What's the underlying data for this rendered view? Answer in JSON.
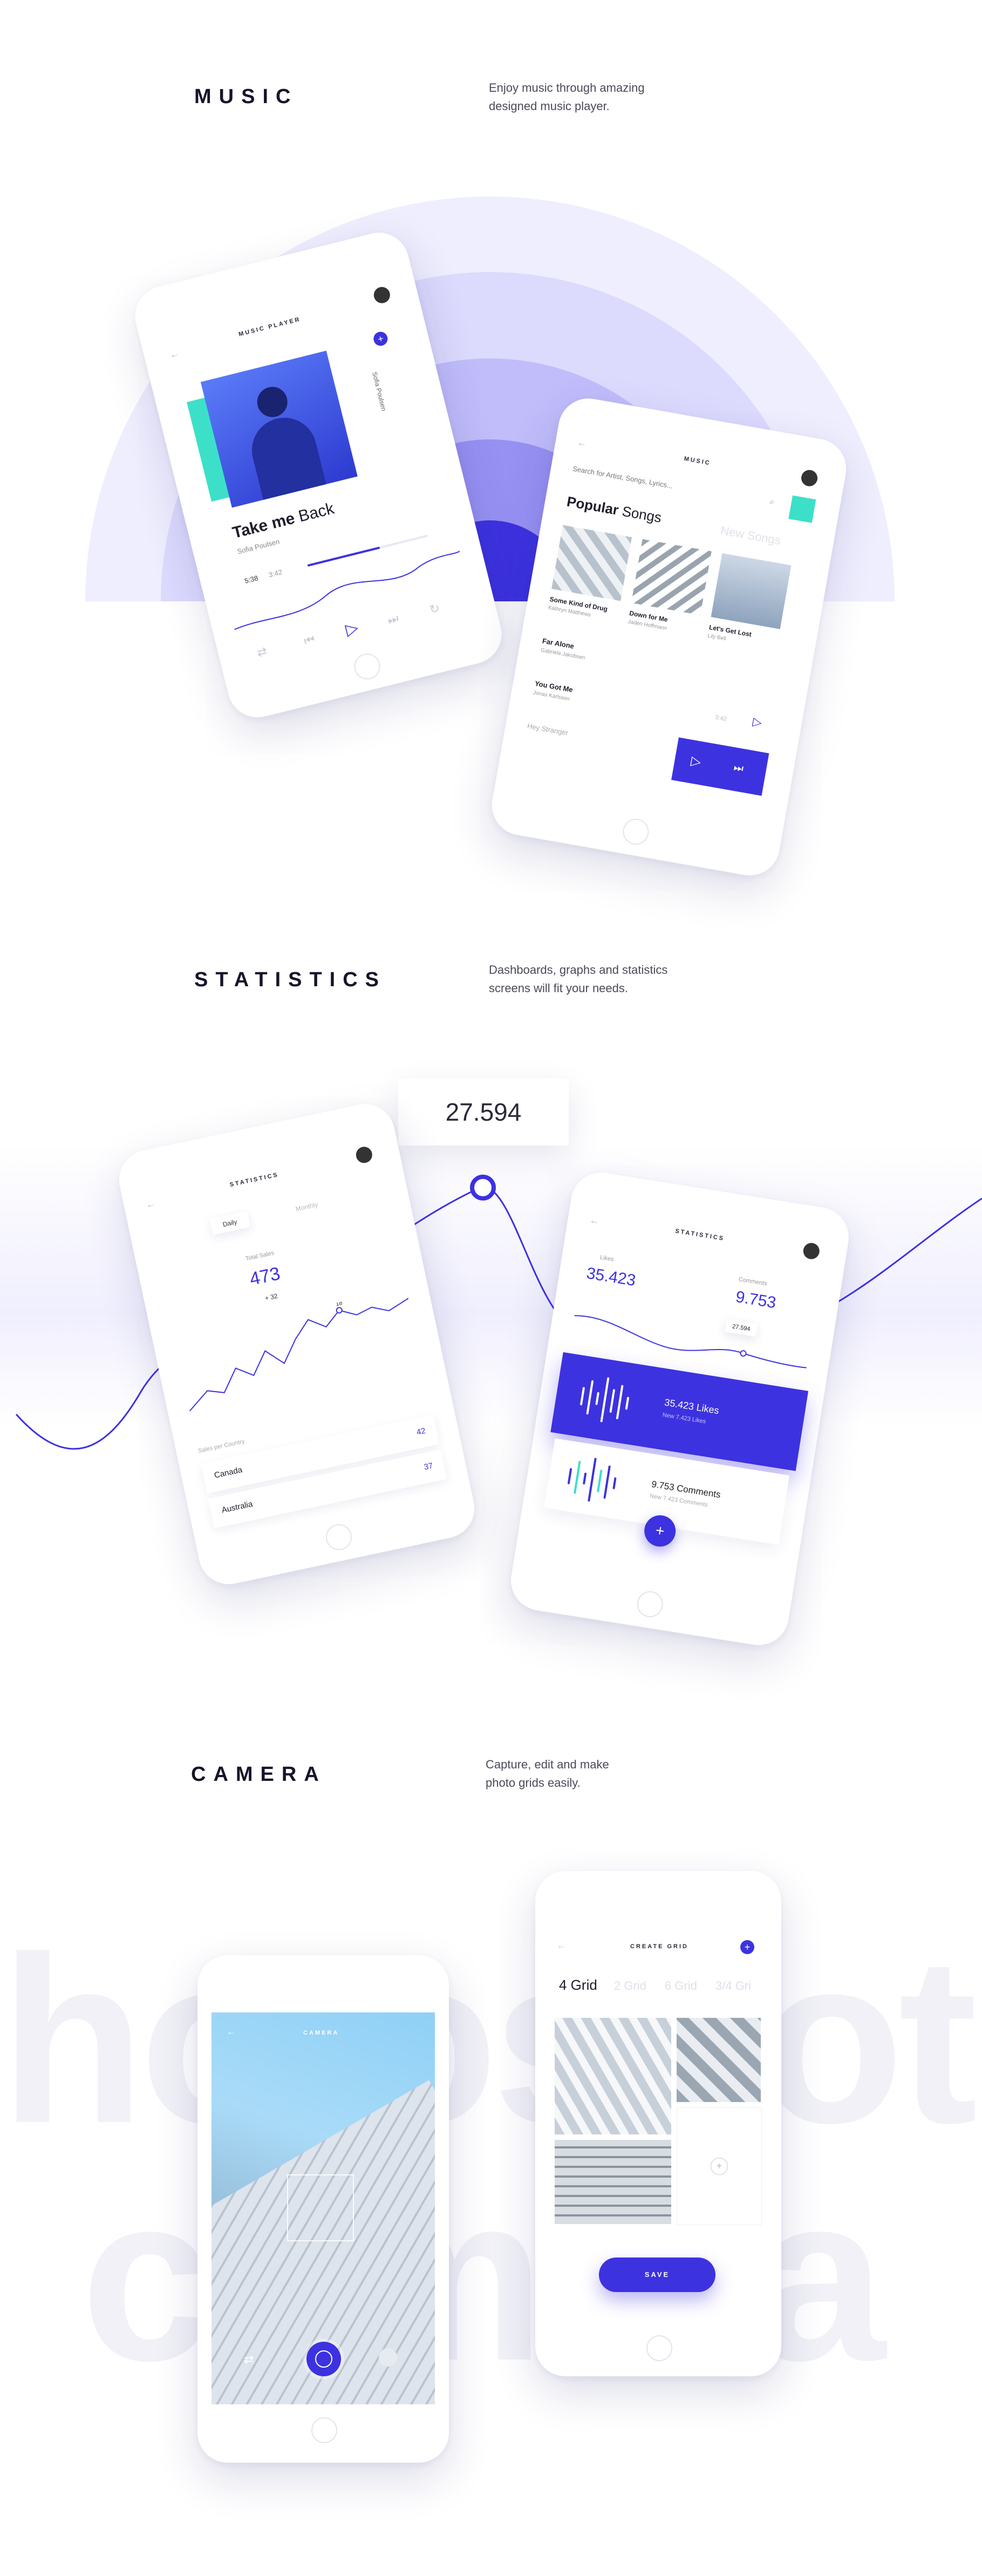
{
  "sections": {
    "music": {
      "title": "MUSIC",
      "desc": "Enjoy music through amazing\ndesigned music player."
    },
    "statistics": {
      "title": "STATISTICS",
      "desc": "Dashboards, graphs and statistics\nscreens will fit your needs."
    },
    "camera": {
      "title": "CAMERA",
      "desc": "Capture, edit and make\nphoto grids easily."
    }
  },
  "player": {
    "header": "MUSIC PLAYER",
    "song": "Take me ",
    "song_accent": "Back",
    "artist": "Sofia Poulsen",
    "time_now": "5:38",
    "time_total": "3:42",
    "side_label": "Sofia Poulsen"
  },
  "library": {
    "header": "MUSIC",
    "search_placeholder": "Search for Artist, Songs, Lyrics...",
    "tab_active_1": "Popular ",
    "tab_active_2": "Songs",
    "tab_inactive": "New Songs",
    "cards": [
      {
        "title": "Some Kind of Drug",
        "artist": "Kathryn Matthews"
      },
      {
        "title": "Down for Me",
        "artist": "Jaden Hoffmann"
      },
      {
        "title": "Let's Get Lost",
        "artist": "Lily Bell"
      }
    ],
    "list": [
      {
        "title": "Far Alone",
        "artist": "Gabriela Jakobsen"
      },
      {
        "title": "You Got Me",
        "artist": "Jonas Karlsson",
        "time": "3:42"
      },
      {
        "title": "Hey Stranger",
        "artist": ""
      }
    ]
  },
  "stats_big_value": "27.594",
  "stats1": {
    "header": "STATISTICS",
    "tab_daily": "Daily",
    "tab_monthly": "Monthly",
    "label": "Total Sales",
    "value": "473",
    "delta": "+ 32",
    "peak_label": "18",
    "sales_by_country": "Sales per Country",
    "rows": [
      {
        "country": "Canada",
        "value": "42"
      },
      {
        "country": "Australia",
        "value": "37"
      }
    ]
  },
  "stats2": {
    "header": "STATISTICS",
    "likes_label": "Likes",
    "likes_value": "35.423",
    "comments_label": "Comments",
    "comments_value": "9.753",
    "tooltip": "27.594",
    "card1_value": "35.423 Likes",
    "card1_sub": "New 7.423 Likes",
    "card2_value": "9.753 Comments",
    "card2_sub": "New 7.423 Comments"
  },
  "bg_text": {
    "line1": "hotoshot",
    "line2": "camera"
  },
  "camera": {
    "header": "CAMERA"
  },
  "grid": {
    "header": "CREATE GRID",
    "tabs": [
      "4 Grid",
      "2 Grid",
      "6 Grid",
      "3/4 Gri"
    ],
    "save": "SAVE"
  },
  "colors": {
    "accent": "#3d32e0",
    "teal": "#3ce0c8",
    "lavender": "#efeefe"
  }
}
